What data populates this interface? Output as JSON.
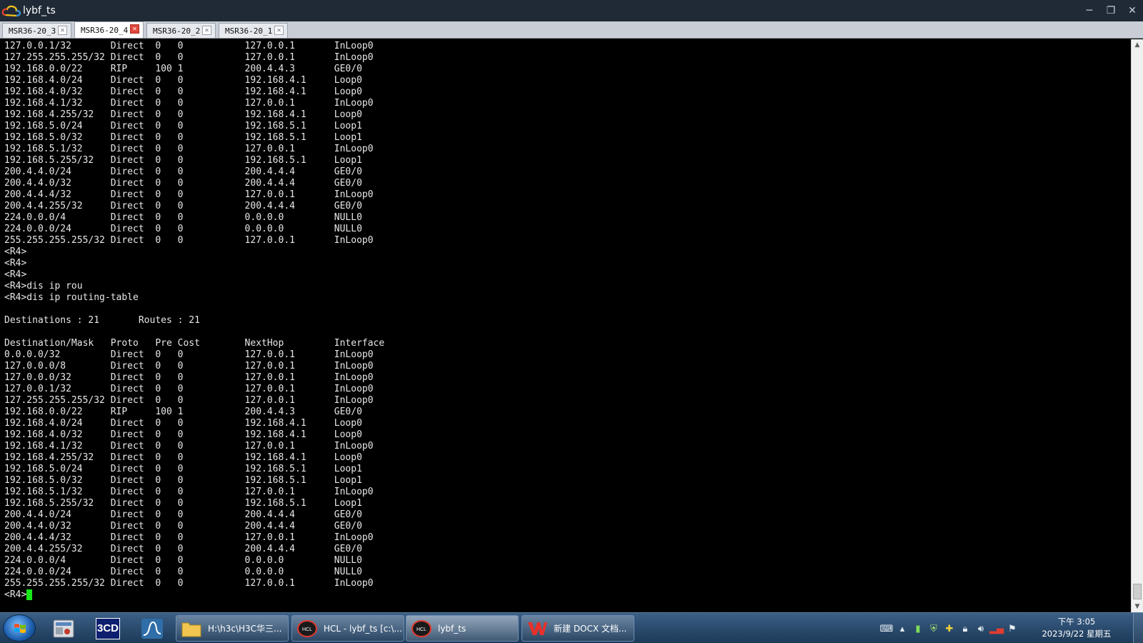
{
  "window": {
    "title": "lybf_ts",
    "controls": {
      "minimize": "─",
      "restore": "❐",
      "close": "✕"
    }
  },
  "tabs": [
    {
      "label": "MSR36-20_3",
      "active": false
    },
    {
      "label": "MSR36-20_4",
      "active": true
    },
    {
      "label": "MSR36-20_2",
      "active": false
    },
    {
      "label": "MSR36-20_1",
      "active": false
    }
  ],
  "terminal": {
    "lines": [
      "127.0.0.1/32       Direct  0   0           127.0.0.1       InLoop0",
      "127.255.255.255/32 Direct  0   0           127.0.0.1       InLoop0",
      "192.168.0.0/22     RIP     100 1           200.4.4.3       GE0/0",
      "192.168.4.0/24     Direct  0   0           192.168.4.1     Loop0",
      "192.168.4.0/32     Direct  0   0           192.168.4.1     Loop0",
      "192.168.4.1/32     Direct  0   0           127.0.0.1       InLoop0",
      "192.168.4.255/32   Direct  0   0           192.168.4.1     Loop0",
      "192.168.5.0/24     Direct  0   0           192.168.5.1     Loop1",
      "192.168.5.0/32     Direct  0   0           192.168.5.1     Loop1",
      "192.168.5.1/32     Direct  0   0           127.0.0.1       InLoop0",
      "192.168.5.255/32   Direct  0   0           192.168.5.1     Loop1",
      "200.4.4.0/24       Direct  0   0           200.4.4.4       GE0/0",
      "200.4.4.0/32       Direct  0   0           200.4.4.4       GE0/0",
      "200.4.4.4/32       Direct  0   0           127.0.0.1       InLoop0",
      "200.4.4.255/32     Direct  0   0           200.4.4.4       GE0/0",
      "224.0.0.0/4        Direct  0   0           0.0.0.0         NULL0",
      "224.0.0.0/24       Direct  0   0           0.0.0.0         NULL0",
      "255.255.255.255/32 Direct  0   0           127.0.0.1       InLoop0",
      "<R4>",
      "<R4>",
      "<R4>",
      "<R4>dis ip rou",
      "<R4>dis ip routing-table",
      "",
      "Destinations : 21       Routes : 21",
      "",
      "Destination/Mask   Proto   Pre Cost        NextHop         Interface",
      "0.0.0.0/32         Direct  0   0           127.0.0.1       InLoop0",
      "127.0.0.0/8        Direct  0   0           127.0.0.1       InLoop0",
      "127.0.0.0/32       Direct  0   0           127.0.0.1       InLoop0",
      "127.0.0.1/32       Direct  0   0           127.0.0.1       InLoop0",
      "127.255.255.255/32 Direct  0   0           127.0.0.1       InLoop0",
      "192.168.0.0/22     RIP     100 1           200.4.4.3       GE0/0",
      "192.168.4.0/24     Direct  0   0           192.168.4.1     Loop0",
      "192.168.4.0/32     Direct  0   0           192.168.4.1     Loop0",
      "192.168.4.1/32     Direct  0   0           127.0.0.1       InLoop0",
      "192.168.4.255/32   Direct  0   0           192.168.4.1     Loop0",
      "192.168.5.0/24     Direct  0   0           192.168.5.1     Loop1",
      "192.168.5.0/32     Direct  0   0           192.168.5.1     Loop1",
      "192.168.5.1/32     Direct  0   0           127.0.0.1       InLoop0",
      "192.168.5.255/32   Direct  0   0           192.168.5.1     Loop1",
      "200.4.4.0/24       Direct  0   0           200.4.4.4       GE0/0",
      "200.4.4.0/32       Direct  0   0           200.4.4.4       GE0/0",
      "200.4.4.4/32       Direct  0   0           127.0.0.1       InLoop0",
      "200.4.4.255/32     Direct  0   0           200.4.4.4       GE0/0",
      "224.0.0.0/4        Direct  0   0           0.0.0.0         NULL0",
      "224.0.0.0/24       Direct  0   0           0.0.0.0         NULL0",
      "255.255.255.255/32 Direct  0   0           127.0.0.1       InLoop0"
    ],
    "prompt": "<R4>",
    "cursor_color": "#19e619"
  },
  "taskbar": {
    "pinned": [
      {
        "name": "control-panel-icon"
      },
      {
        "label": "3CD",
        "name": "3cd-daemon-icon"
      },
      {
        "name": "wireshark-icon"
      }
    ],
    "tasks": [
      {
        "label": "H:\\h3c\\H3C华三...",
        "icon": "folder-icon",
        "active": false
      },
      {
        "label": "HCL - lybf_ts [c:\\...",
        "icon": "hcl-icon",
        "active": false
      },
      {
        "label": "lybf_ts",
        "icon": "hcl-icon",
        "active": true
      },
      {
        "label": "新建 DOCX 文档...",
        "icon": "wps-icon",
        "active": false
      }
    ],
    "clock": {
      "time": "下午 3:05",
      "date": "2023/9/22 星期五"
    }
  },
  "colors": {
    "titlebar": "#1f2a36",
    "terminal_bg": "#000000",
    "terminal_fg": "#e7e7e7",
    "active_tab_close": "#e0463b"
  }
}
